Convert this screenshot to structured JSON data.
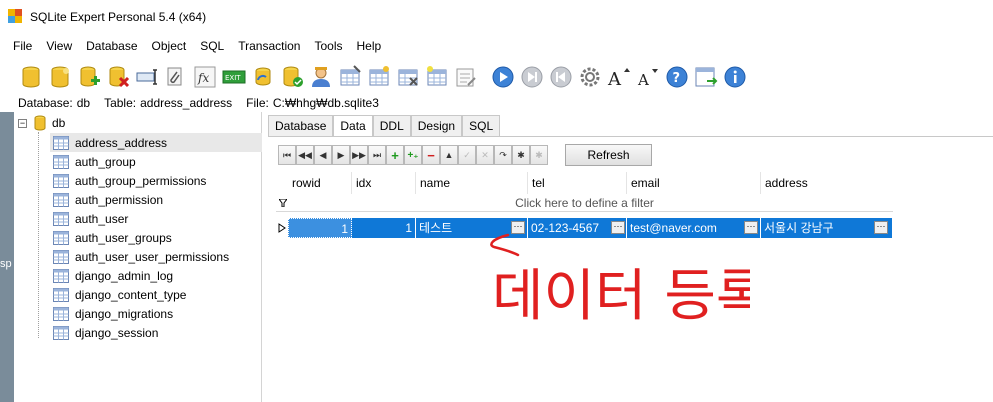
{
  "window": {
    "title": "SQLite Expert Personal 5.4 (x64)"
  },
  "menu": [
    "File",
    "View",
    "Database",
    "Object",
    "SQL",
    "Transaction",
    "Tools",
    "Help"
  ],
  "toolbar": {
    "icons": [
      "new-database-icon",
      "open-database-icon",
      "attach-database-icon",
      "detach-database-icon",
      "rename-icon",
      "attachment-icon",
      "function-icon",
      "exit-icon",
      "refresh-database-icon",
      "check-database-icon",
      "user-icon",
      "table-design-icon",
      "new-table-icon",
      "delete-table-icon",
      "new-view-icon",
      "edit-icon",
      "run-icon",
      "step-icon",
      "stop-icon",
      "settings-icon",
      "increase-font-icon",
      "decrease-font-icon",
      "help-icon",
      "export-icon",
      "info-icon"
    ]
  },
  "pathbar": {
    "database_label": "Database:",
    "database_value": "db",
    "table_label": "Table:",
    "table_value": "address_address",
    "file_label": "File:",
    "file_value": "C:₩hhg₩db.sqlite3"
  },
  "leftstrip": {
    "text": "sp"
  },
  "tree": {
    "root": "db",
    "items": [
      "address_address",
      "auth_group",
      "auth_group_permissions",
      "auth_permission",
      "auth_user",
      "auth_user_groups",
      "auth_user_user_permissions",
      "django_admin_log",
      "django_content_type",
      "django_migrations",
      "django_session"
    ],
    "selected": "address_address"
  },
  "tabs": [
    "Database",
    "Data",
    "DDL",
    "Design",
    "SQL"
  ],
  "active_tab": "Data",
  "navigator": {
    "refresh_label": "Refresh"
  },
  "grid": {
    "columns": [
      "rowid",
      "idx",
      "name",
      "tel",
      "email",
      "address"
    ],
    "filter_hint": "Click here to define a filter",
    "rows": [
      {
        "rowid": "1",
        "idx": "1",
        "name": "테스트",
        "tel": "02-123-4567",
        "email": "test@naver.com",
        "address": "서울시 강남구"
      }
    ]
  },
  "annotation": {
    "text": "데이터 등록",
    "color": "#e02020"
  },
  "colors": {
    "selection": "#0f78d7",
    "annotation": "#e02020"
  }
}
